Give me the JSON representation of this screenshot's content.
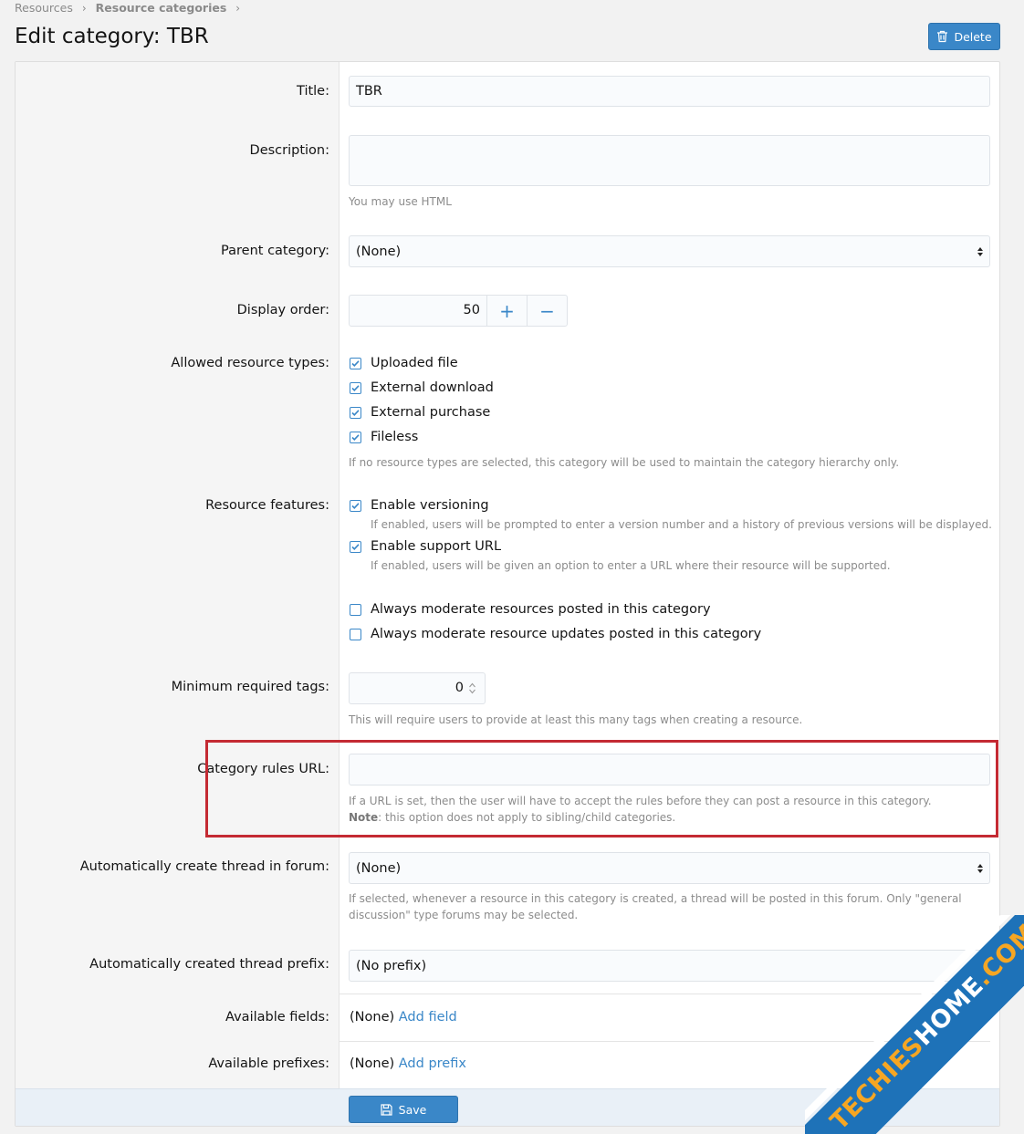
{
  "breadcrumb": {
    "items": [
      "Resources",
      "Resource categories"
    ]
  },
  "page": {
    "title": "Edit category: TBR",
    "delete_label": "Delete"
  },
  "form": {
    "title": {
      "label": "Title:",
      "value": "TBR"
    },
    "description": {
      "label": "Description:",
      "value": "",
      "hint": "You may use HTML"
    },
    "parent_category": {
      "label": "Parent category:",
      "value": "(None)"
    },
    "display_order": {
      "label": "Display order:",
      "value": "50",
      "plus": "+",
      "minus": "−"
    },
    "allowed_types": {
      "label": "Allowed resource types:",
      "options": [
        {
          "label": "Uploaded file",
          "checked": true
        },
        {
          "label": "External download",
          "checked": true
        },
        {
          "label": "External purchase",
          "checked": true
        },
        {
          "label": "Fileless",
          "checked": true
        }
      ],
      "hint": "If no resource types are selected, this category will be used to maintain the category hierarchy only."
    },
    "features": {
      "label": "Resource features:",
      "versioning": {
        "label": "Enable versioning",
        "checked": true,
        "hint": "If enabled, users will be prompted to enter a version number and a history of previous versions will be displayed."
      },
      "support_url": {
        "label": "Enable support URL",
        "checked": true,
        "hint": "If enabled, users will be given an option to enter a URL where their resource will be supported."
      },
      "moderate_resources": {
        "label": "Always moderate resources posted in this category",
        "checked": false
      },
      "moderate_updates": {
        "label": "Always moderate resource updates posted in this category",
        "checked": false
      }
    },
    "min_tags": {
      "label": "Minimum required tags:",
      "value": "0",
      "hint": "This will require users to provide at least this many tags when creating a resource."
    },
    "rules_url": {
      "label": "Category rules URL:",
      "value": "",
      "hint": "If a URL is set, then the user will have to accept the rules before they can post a resource in this category.",
      "note_label": "Note",
      "note_text": ": this option does not apply to sibling/child categories."
    },
    "thread_forum": {
      "label": "Automatically create thread in forum:",
      "value": "(None)",
      "hint_line1": "If selected, whenever a resource in this category is created, a thread will be posted in this forum. Only \"general",
      "hint_line2": "discussion\" type forums may be selected."
    },
    "thread_prefix": {
      "label": "Automatically created thread prefix:",
      "value": "(No prefix)"
    },
    "fields": {
      "label": "Available fields:",
      "value": "(None)",
      "link": "Add field"
    },
    "prefixes": {
      "label": "Available prefixes:",
      "value": "(None)",
      "link": "Add prefix"
    }
  },
  "footer": {
    "save_label": "Save"
  },
  "watermark": {
    "part1": "TECHIES",
    "part2": "HOME",
    "part3": ".COM"
  },
  "colors": {
    "accent": "#3a87c8",
    "highlight": "#c42a33",
    "label_bg": "#f5f5f5"
  }
}
